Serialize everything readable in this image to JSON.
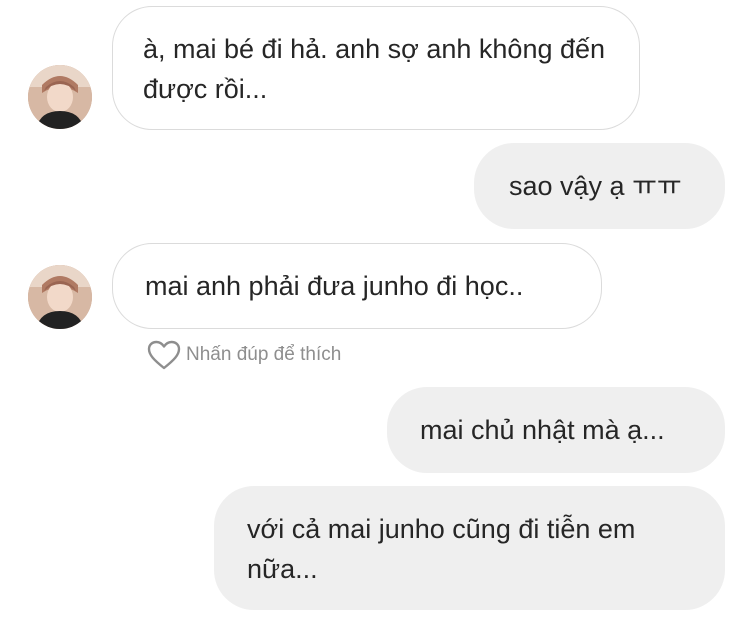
{
  "messages": [
    {
      "id": "msg1",
      "side": "received",
      "text": "à, mai bé đi hả. anh sợ anh không đến được rồi..."
    },
    {
      "id": "msg2",
      "side": "sent",
      "text": "sao vậy ạ ㅠㅠ"
    },
    {
      "id": "msg3",
      "side": "received",
      "text": "mai anh phải đưa junho đi học.."
    },
    {
      "id": "msg4",
      "side": "sent",
      "text": "mai chủ nhật mà ạ..."
    },
    {
      "id": "msg5",
      "side": "sent",
      "text": "với cả mai junho cũng đi tiễn em nữa..."
    }
  ],
  "like_hint": {
    "icon": "heart-outline-icon",
    "text": "Nhấn đúp để thích"
  },
  "colors": {
    "received_bubble_bg": "#ffffff",
    "received_bubble_border": "#dbdbdb",
    "sent_bubble_bg": "#efefef",
    "text": "#262626",
    "hint_text": "#8e8e8e"
  }
}
